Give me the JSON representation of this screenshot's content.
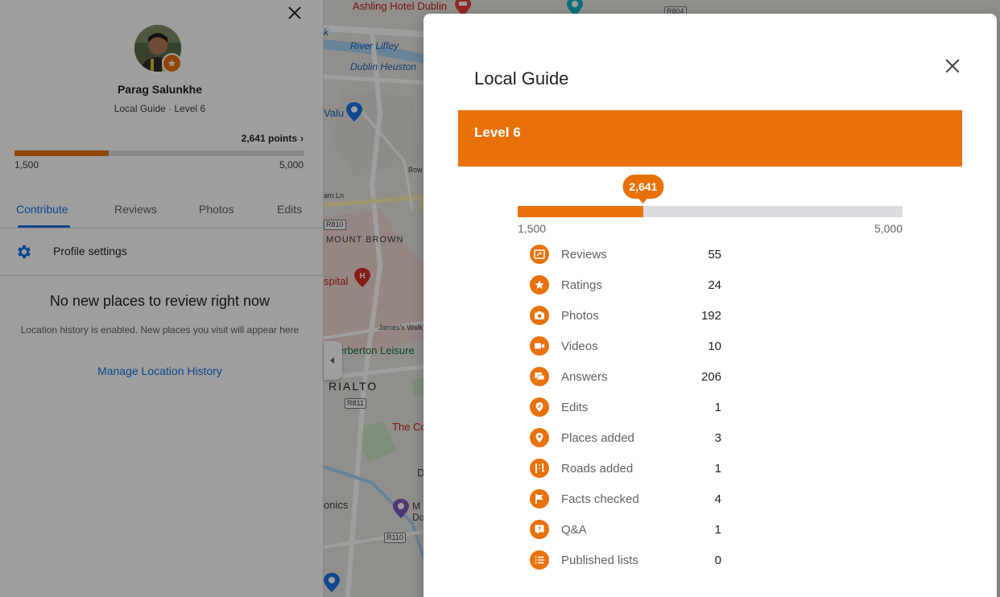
{
  "map": {
    "labels": {
      "ashling": "Ashling Hotel Dublin",
      "river": "River Liffey",
      "heuston": "Dublin Heuston",
      "valu": "Valu",
      "mount_brown": "MOUNT BROWN",
      "hospital": "spital",
      "leisure": "erberton Leisure",
      "rialto": "RIALTO",
      "the_co": "The Co",
      "onics": "onics",
      "d": "D",
      "mdo": "M Do",
      "k": "k",
      "bow": "Bow",
      "am_ln": "am Ln",
      "james_walk": "James's Walk"
    },
    "road_shields": {
      "r804": "R804",
      "r810": "R810",
      "r811": "R811",
      "r110": "R110"
    }
  },
  "left_panel": {
    "name": "Parag Salunkhe",
    "subtitle": "Local Guide · Level 6",
    "points_label": "2,641 points",
    "points_chevron": "›",
    "progress": {
      "min": "1,500",
      "max": "5,000",
      "fraction": 0.326
    },
    "tabs": [
      "Contribute",
      "Reviews",
      "Photos",
      "Edits"
    ],
    "settings_label": "Profile settings",
    "empty_title": "No new places to review right now",
    "empty_desc": "Location history is enabled. New places you visit will appear here",
    "manage_link": "Manage Location History"
  },
  "dialog": {
    "title": "Local Guide",
    "level": "Level 6",
    "points": "2,641",
    "progress": {
      "min": "1,500",
      "max": "5,000",
      "fraction": 0.326
    },
    "stats": [
      {
        "label": "Reviews",
        "value": "55",
        "icon": "review-icon"
      },
      {
        "label": "Ratings",
        "value": "24",
        "icon": "star-icon"
      },
      {
        "label": "Photos",
        "value": "192",
        "icon": "camera-icon"
      },
      {
        "label": "Videos",
        "value": "10",
        "icon": "video-icon"
      },
      {
        "label": "Answers",
        "value": "206",
        "icon": "answers-icon"
      },
      {
        "label": "Edits",
        "value": "1",
        "icon": "edit-pin-icon"
      },
      {
        "label": "Places added",
        "value": "3",
        "icon": "add-place-icon"
      },
      {
        "label": "Roads added",
        "value": "1",
        "icon": "road-icon"
      },
      {
        "label": "Facts checked",
        "value": "4",
        "icon": "flag-icon"
      },
      {
        "label": "Q&A",
        "value": "1",
        "icon": "qa-icon"
      },
      {
        "label": "Published lists",
        "value": "0",
        "icon": "list-icon"
      }
    ]
  },
  "colors": {
    "accent": "#e8710a",
    "link": "#1a73e8"
  }
}
